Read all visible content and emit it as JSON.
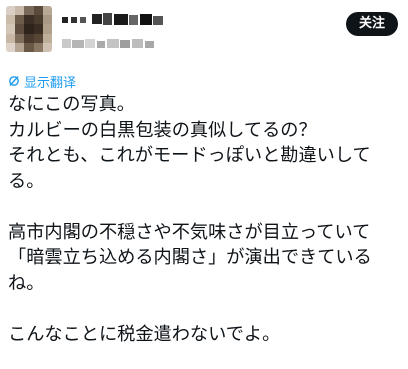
{
  "post": {
    "follow_label": "关注",
    "translate_label": "显示翻译",
    "lines": [
      "なにこの写真。",
      "カルビーの白黒包装の真似してるの？",
      "それとも、これがモードっぽいと勘違いして",
      "る。",
      "",
      "高市内閣の不穏さや不気味さが目立っていて",
      "「暗雲立ち込める内閣さ」が演出できている",
      "ね。",
      "",
      "こんなことに税金遣わないでよ。"
    ]
  },
  "colors": {
    "link": "#1d9bf0",
    "text": "#0f1419",
    "button_bg": "#0f1419",
    "button_text": "#ffffff"
  },
  "icons": {
    "translate": "translate-icon",
    "avatar": "avatar"
  }
}
